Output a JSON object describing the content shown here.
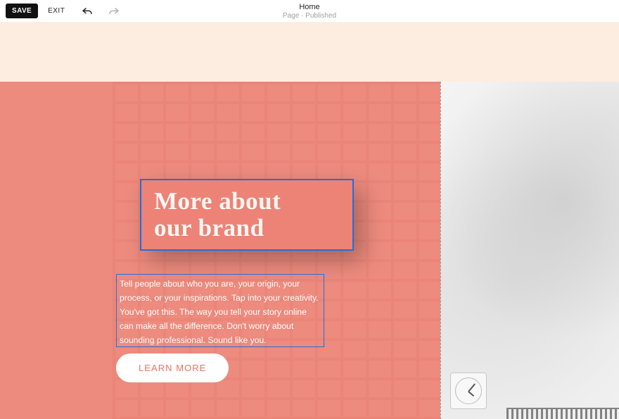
{
  "toolbar": {
    "save_label": "SAVE",
    "exit_label": "EXIT"
  },
  "page_info": {
    "title": "Home",
    "status": "Page · Published"
  },
  "hero": {
    "headline_line1": "More about",
    "headline_line2": "our brand",
    "paragraph": "Tell people about who you are, your origin, your process, or your inspirations. Tap into your creativity. You've got this. The way you tell your story online can make all the difference. Don't worry about sounding professional. Sound like you.",
    "cta_label": "LEARN MORE"
  },
  "colors": {
    "accent_coral": "#ed8b7e",
    "banner_peach": "#fdece0",
    "selection_blue": "#1f6fe0"
  }
}
